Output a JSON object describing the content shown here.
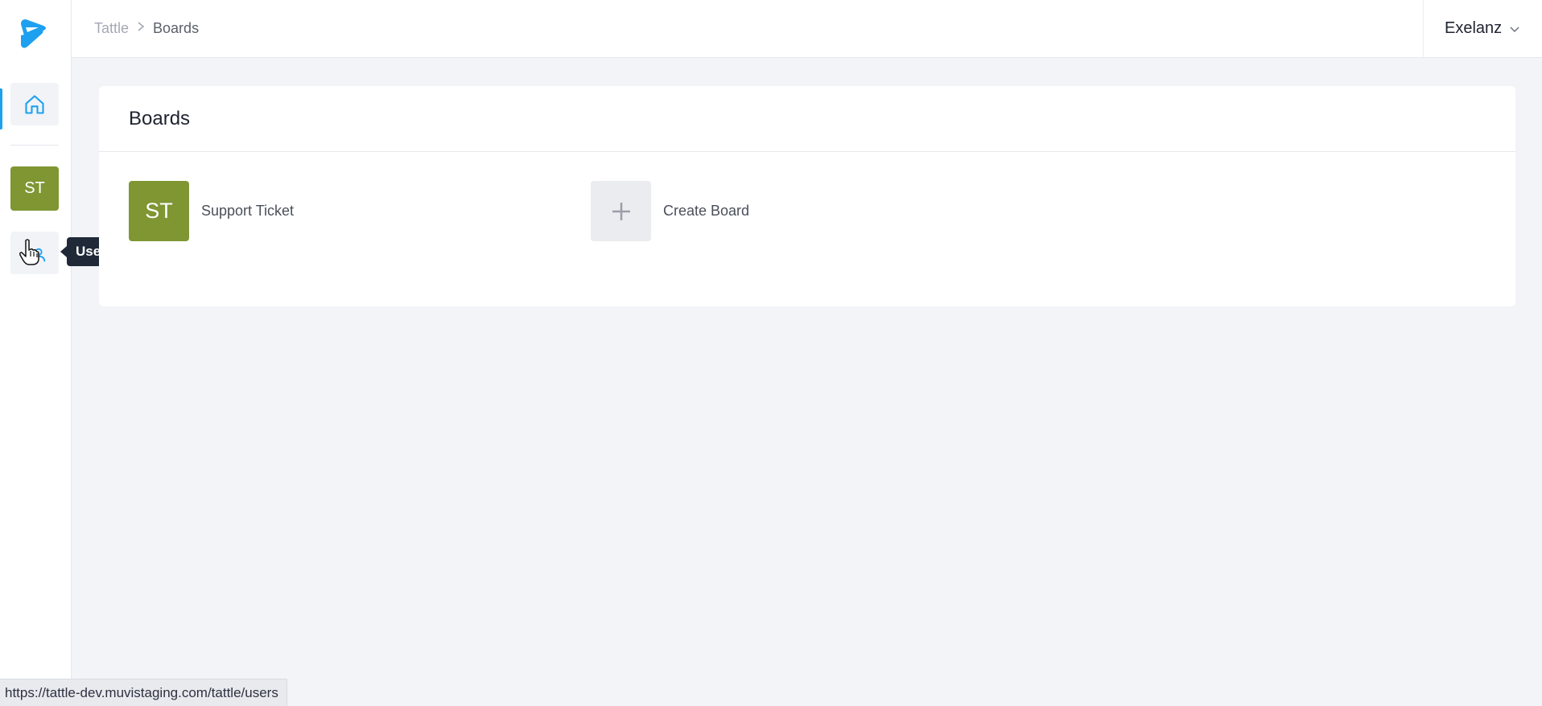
{
  "breadcrumb": {
    "root": "Tattle",
    "current": "Boards"
  },
  "org": {
    "name": "Exelanz"
  },
  "sidebar": {
    "home_icon": "home-icon",
    "board_initials": "ST",
    "user_icon": "user-icon",
    "tooltip": "User"
  },
  "main": {
    "title": "Boards",
    "boards": [
      {
        "initials": "ST",
        "label": "Support Ticket"
      }
    ],
    "create": {
      "label": "Create Board"
    }
  },
  "status": {
    "url": "https://tattle-dev.muvistaging.com/tattle/users"
  },
  "colors": {
    "accent": "#1ea0f0",
    "board": "#7f9633",
    "tooltip_bg": "#1f2937"
  }
}
